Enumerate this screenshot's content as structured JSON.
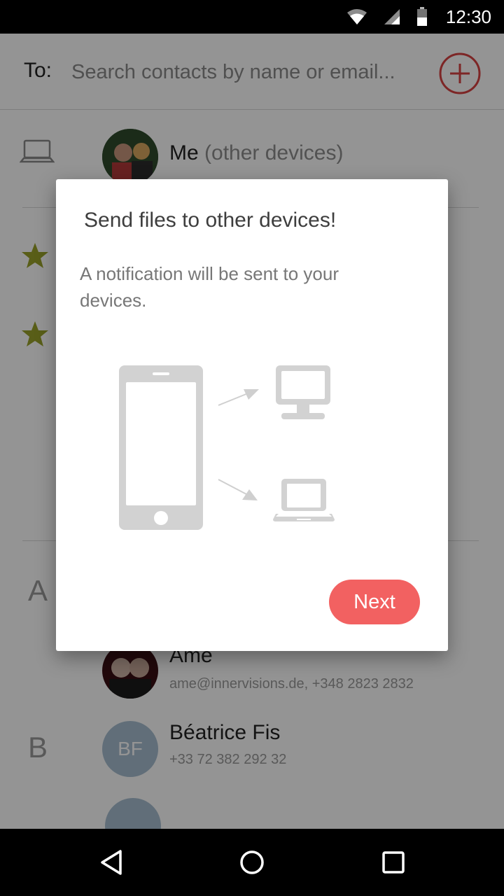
{
  "status_bar": {
    "time": "12:30",
    "icons": [
      "wifi-icon",
      "cell-signal-icon",
      "battery-icon"
    ]
  },
  "header": {
    "to_label": "To:",
    "search_placeholder": "Search contacts by name or email...",
    "add_icon": "add-circle-icon",
    "accent_color": "#d84343"
  },
  "devices_row": {
    "icon": "laptop-icon",
    "name": "Me",
    "name_suffix": "(other devices)"
  },
  "favorites": {
    "icon": "star-icon",
    "star_color": "#9aa32a"
  },
  "sections": [
    {
      "letter": "A",
      "contacts": [
        {
          "name": "Ame",
          "detail": "ame@innervisions.de, +348 2823 2832"
        }
      ]
    },
    {
      "letter": "B",
      "contacts": [
        {
          "name": "Béatrice Fis",
          "initials": "BF",
          "detail": "+33 72 382 292 32"
        }
      ]
    }
  ],
  "dialog": {
    "title": "Send files to other devices!",
    "body": "A notification will be sent to your devices.",
    "illustration_icons": [
      "phone-icon",
      "arrow-icon",
      "desktop-icon",
      "laptop-icon"
    ],
    "next_label": "Next",
    "button_color": "#f26161"
  },
  "nav_bar": {
    "buttons": [
      "back-icon",
      "home-icon",
      "recents-icon"
    ]
  }
}
